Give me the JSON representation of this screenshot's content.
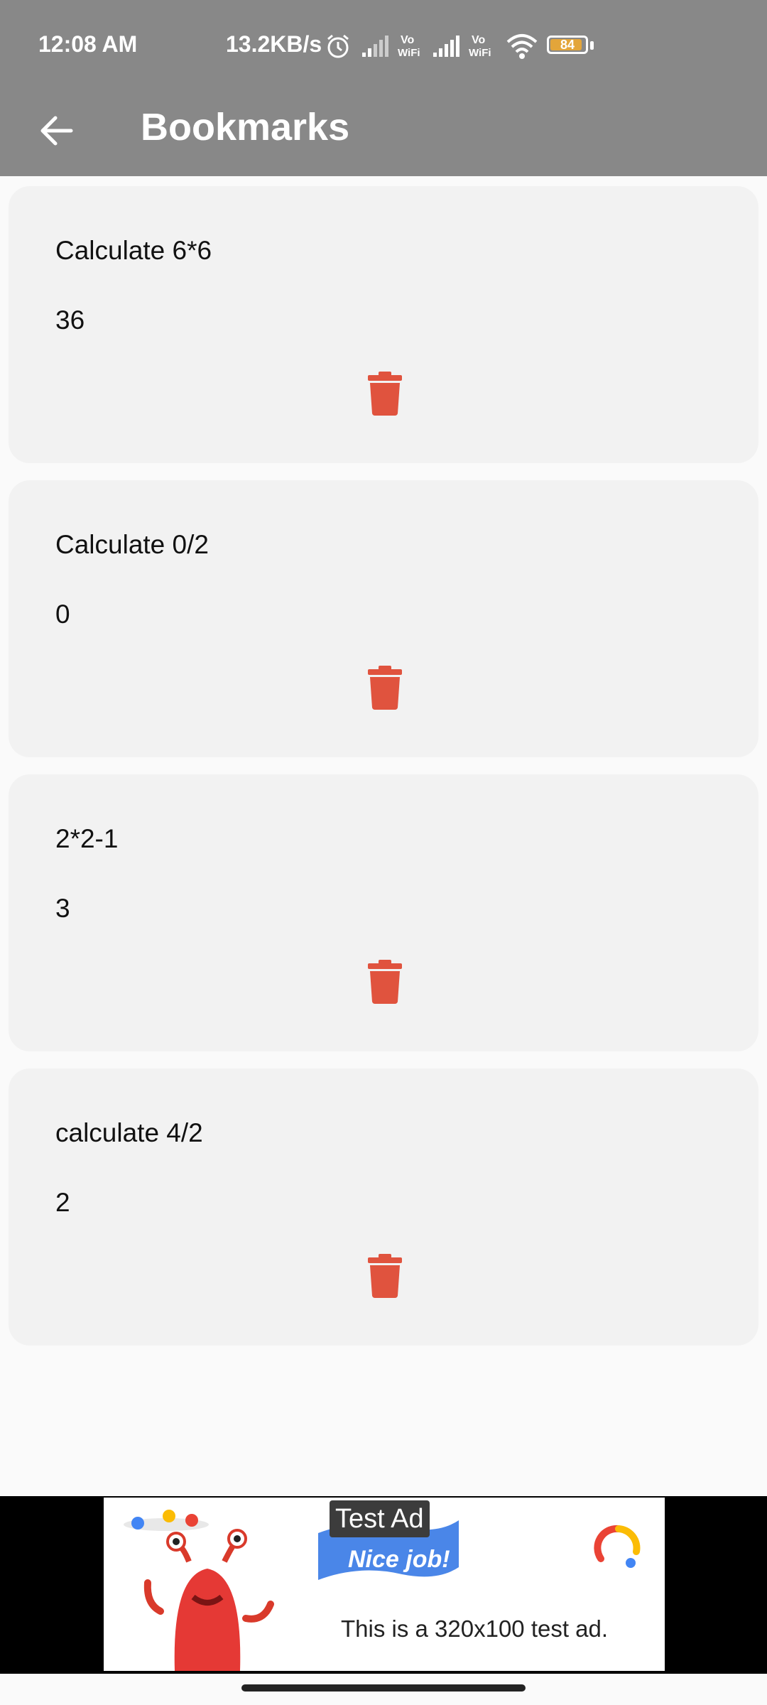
{
  "status_bar": {
    "time": "12:08 AM",
    "net_speed": "13.2KB/s",
    "vo_wifi_1": "Vo WiFi",
    "vo_wifi_2": "Vo WiFi",
    "battery_level": "84",
    "battery_color": "#e3a53a",
    "icons": [
      "alarm-icon",
      "signal-icon",
      "vowifi-icon",
      "signal-icon",
      "vowifi-icon",
      "wifi-icon",
      "battery-icon"
    ]
  },
  "app_bar": {
    "back_icon": "arrow-back-icon",
    "title": "Bookmarks",
    "background": "#888888"
  },
  "bookmarks": [
    {
      "question": "Calculate 6*6",
      "answer": "36",
      "delete_icon": "trash-icon"
    },
    {
      "question": "Calculate 0/2",
      "answer": "0",
      "delete_icon": "trash-icon"
    },
    {
      "question": "2*2-1",
      "answer": "3",
      "delete_icon": "trash-icon"
    },
    {
      "question": "calculate 4/2",
      "answer": "2",
      "delete_icon": "trash-icon"
    }
  ],
  "colors": {
    "delete": "#e0533e",
    "card": "#f2f2f2"
  },
  "ad": {
    "label": "Test Ad",
    "banner_text": "Nice job!",
    "text": "This is a 320x100 test ad."
  }
}
